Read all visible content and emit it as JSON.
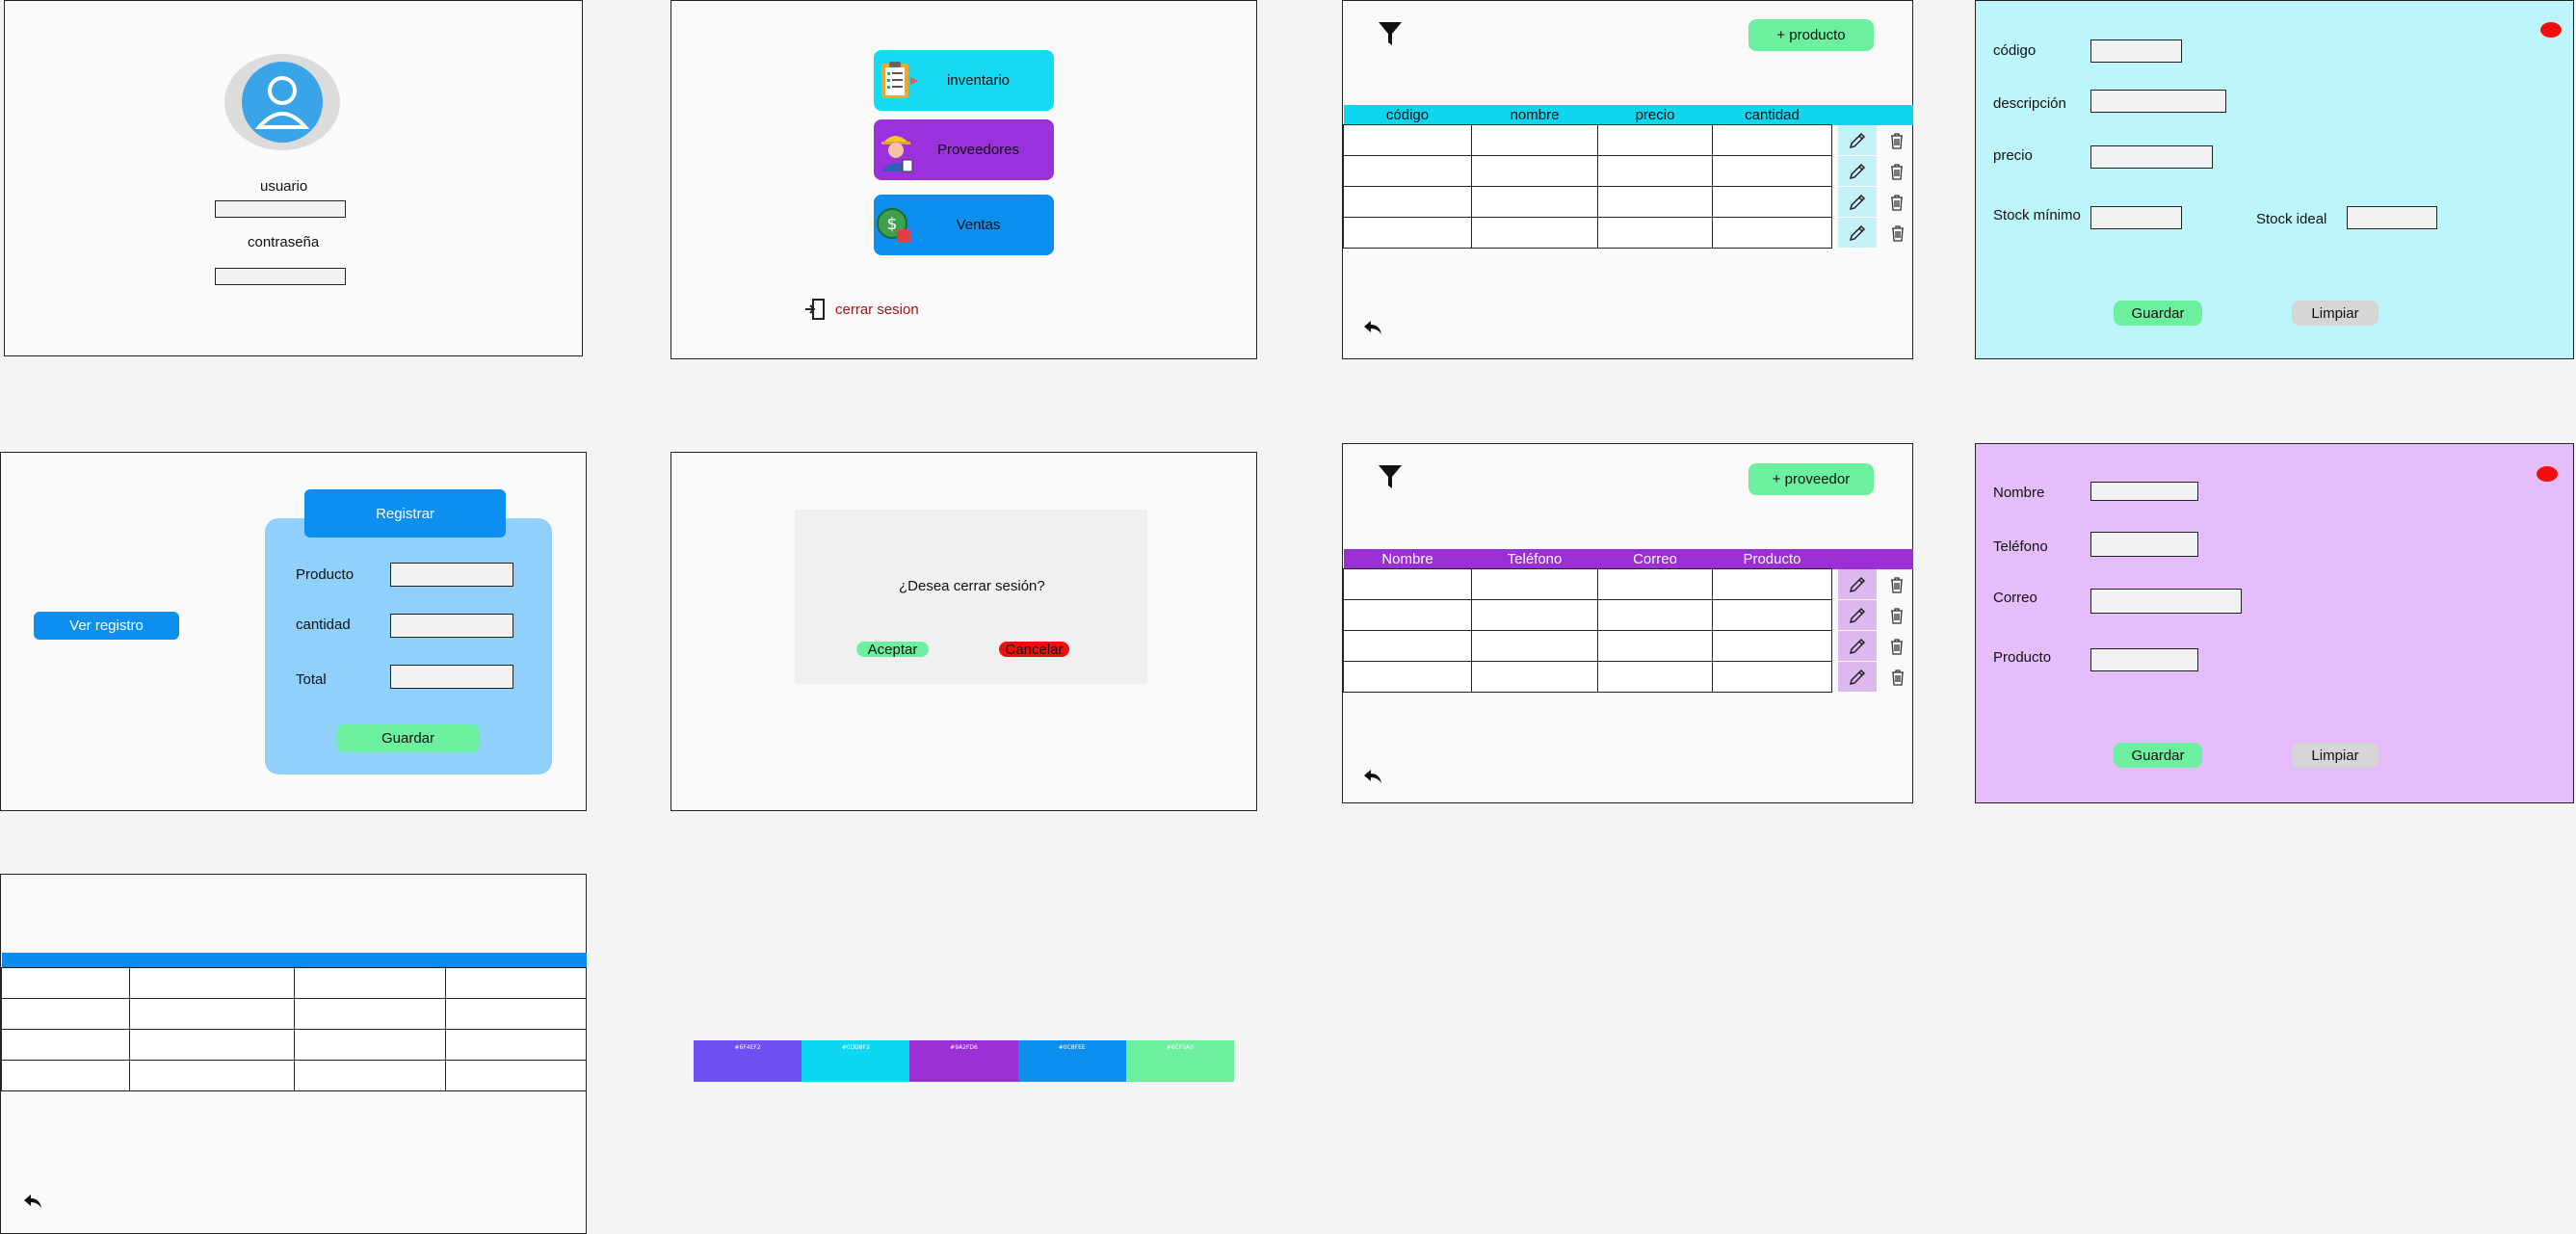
{
  "login": {
    "user_label": "usuario",
    "password_label": "contraseña"
  },
  "menu": {
    "items": [
      {
        "label": "inventario",
        "color": "#16d9f2",
        "icon": "clipboard-icon"
      },
      {
        "label": "Proveedores",
        "color": "#9b30dd",
        "icon": "worker-icon"
      },
      {
        "label": "Ventas",
        "color": "#0c8fee",
        "icon": "money-icon"
      }
    ],
    "logout_label": "cerrar sesion",
    "logout_color": "#b01010"
  },
  "products": {
    "add_label": "+ producto",
    "columns": [
      "código",
      "nombre",
      "precio",
      "cantidad"
    ],
    "row_count": 4
  },
  "product_form": {
    "code_label": "código",
    "description_label": "descripción",
    "price_label": "precio",
    "min_stock_label": "Stock mínimo",
    "ideal_stock_label": "Stock ideal",
    "save_label": "Guardar",
    "clear_label": "Limpiar",
    "background": "#bdf5fc"
  },
  "sales": {
    "view_label": "Ver registro",
    "register_label": "Registrar",
    "product_label": "Producto",
    "quantity_label": "cantidad",
    "total_label": "Total",
    "save_label": "Guardar"
  },
  "logout_dialog": {
    "question": "¿Desea cerrar sesión?",
    "accept_label": "Aceptar",
    "cancel_label": "Cancelar"
  },
  "suppliers": {
    "add_label": "+ proveedor",
    "columns": [
      "Nombre",
      "Teléfono",
      "Correo",
      "Producto"
    ],
    "row_count": 4
  },
  "supplier_form": {
    "name_label": "Nombre",
    "phone_label": "Teléfono",
    "email_label": "Correo",
    "product_label": "Producto",
    "save_label": "Guardar",
    "clear_label": "Limpiar",
    "background": "#e4bdfa"
  },
  "records": {
    "row_count": 4
  },
  "palette": {
    "swatches": [
      {
        "label": "#6F4EF2",
        "color": "#6f4ef2"
      },
      {
        "label": "#0DD8F2",
        "color": "#0dd8f2"
      },
      {
        "label": "#9A2FD6",
        "color": "#9a2fd6"
      },
      {
        "label": "#0C8FEE",
        "color": "#0c8fee"
      },
      {
        "label": "#6CF0A0",
        "color": "#6cf0a0"
      }
    ]
  }
}
